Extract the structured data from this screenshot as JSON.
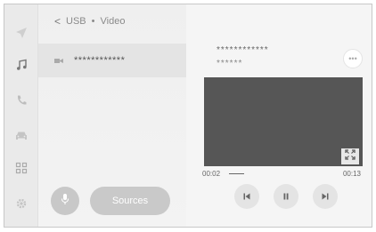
{
  "breadcrumb": {
    "back_glyph": "<",
    "source": "USB",
    "separator": "•",
    "mode": "Video"
  },
  "file_list": {
    "item_name": "************"
  },
  "buttons": {
    "sources_label": "Sources",
    "more_label": "•••"
  },
  "now_playing": {
    "title": "************",
    "subtitle": "******"
  },
  "playback": {
    "elapsed": "00:02",
    "total": "00:13",
    "progress_fraction": 0.154
  },
  "rail_icons": [
    "navigation-icon",
    "music-icon",
    "phone-icon",
    "car-icon",
    "apps-icon",
    "settings-icon"
  ],
  "colors": {
    "video_bg": "#565656",
    "button_bg": "#c9c9c9"
  }
}
